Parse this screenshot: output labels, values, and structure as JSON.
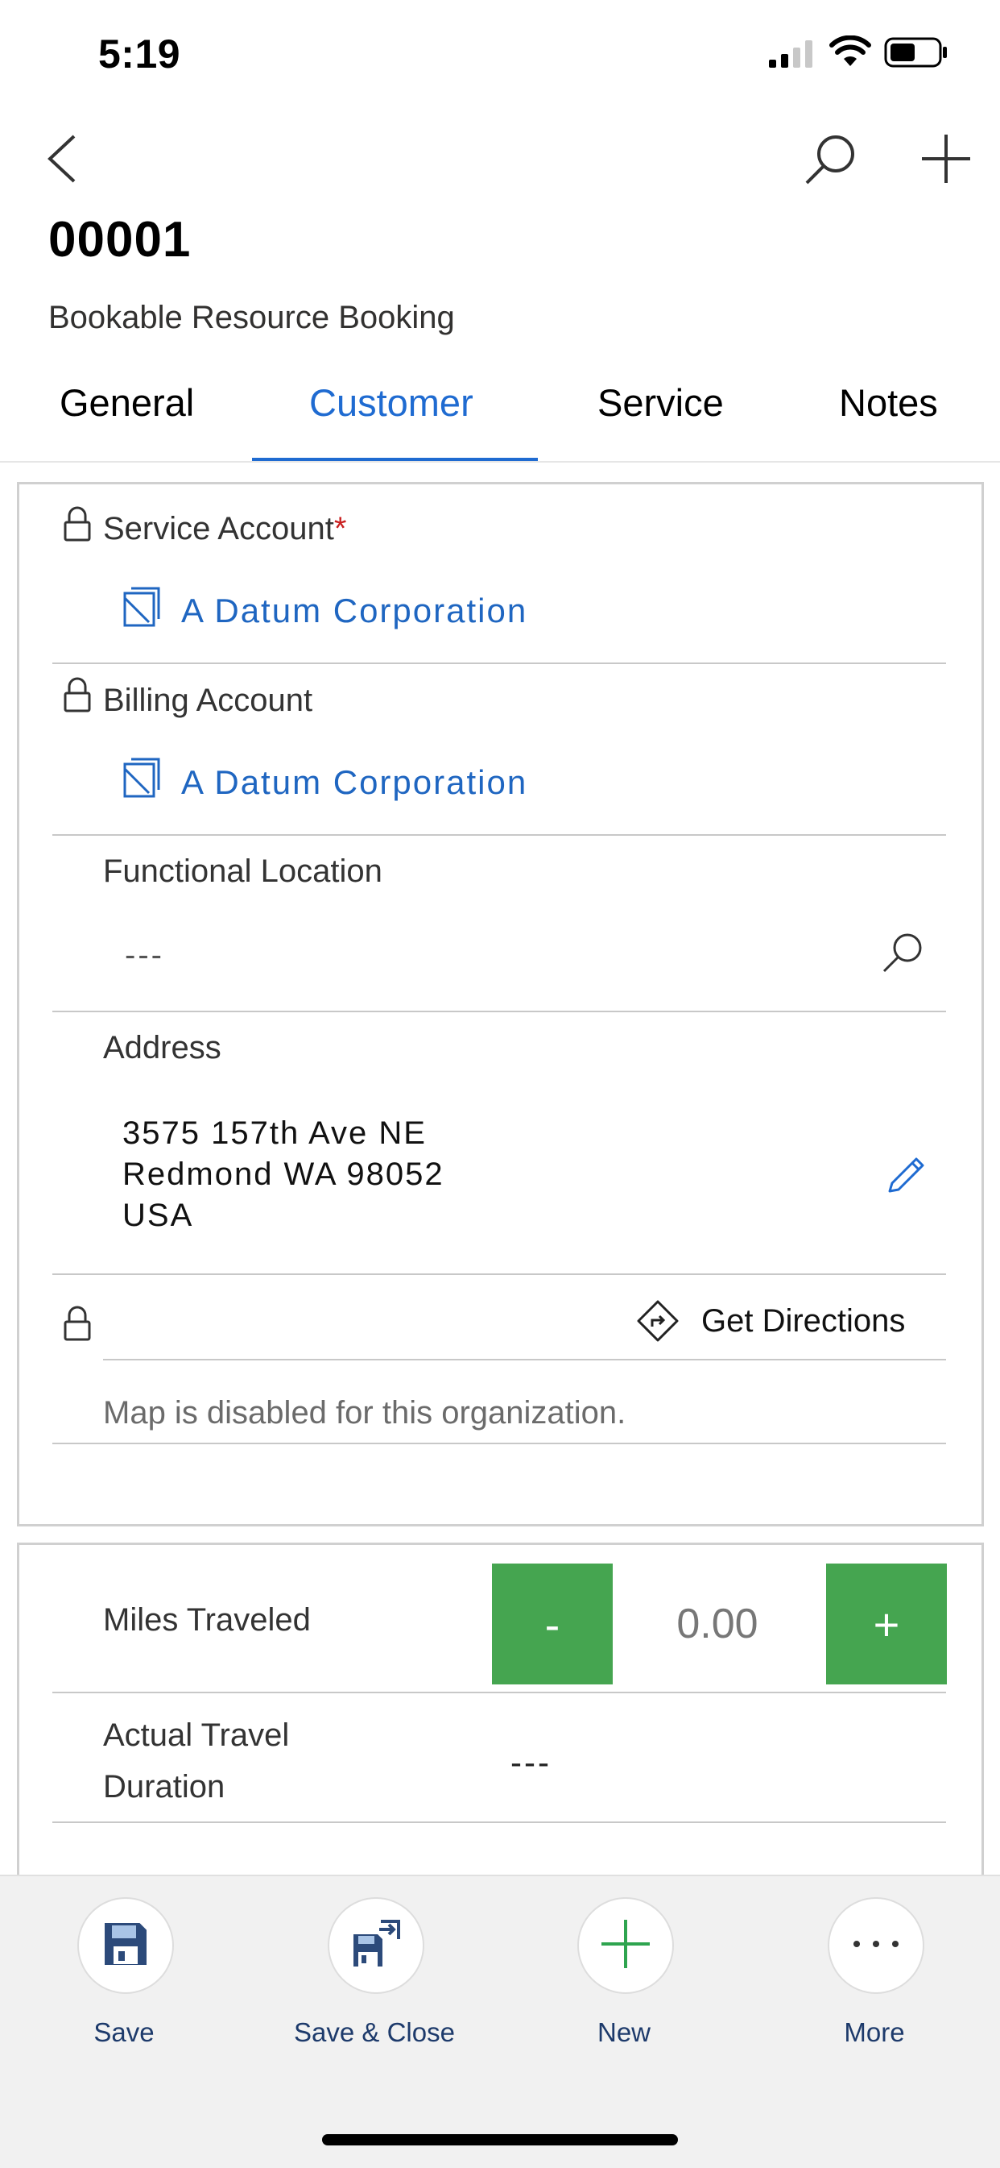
{
  "status_bar": {
    "time": "5:19"
  },
  "header": {
    "title": "00001",
    "subtitle": "Bookable Resource Booking"
  },
  "tabs": [
    {
      "label": "General"
    },
    {
      "label": "Customer"
    },
    {
      "label": "Service"
    },
    {
      "label": "Notes"
    }
  ],
  "customer": {
    "service_account_label": "Service Account",
    "required_mark": "*",
    "service_account_value": "A Datum Corporation",
    "billing_account_label": "Billing Account",
    "billing_account_value": "A Datum Corporation",
    "functional_location_label": "Functional Location",
    "functional_location_value": "---",
    "address_label": "Address",
    "address_line1": "3575 157th Ave NE",
    "address_line2": "Redmond WA 98052",
    "address_line3": "USA",
    "get_directions": "Get Directions",
    "map_disabled": "Map is disabled for this organization."
  },
  "travel": {
    "miles_label": "Miles Traveled",
    "minus": "-",
    "miles_value": "0.00",
    "plus": "+",
    "duration_label_1": "Actual Travel",
    "duration_label_2": "Duration",
    "duration_value": "---"
  },
  "toolbar": {
    "save": "Save",
    "save_close": "Save & Close",
    "new": "New",
    "more": "More"
  },
  "colors": {
    "accent": "#1f6bd1",
    "link": "#1f66c1",
    "green": "#45a550",
    "required": "#c91f1f"
  }
}
